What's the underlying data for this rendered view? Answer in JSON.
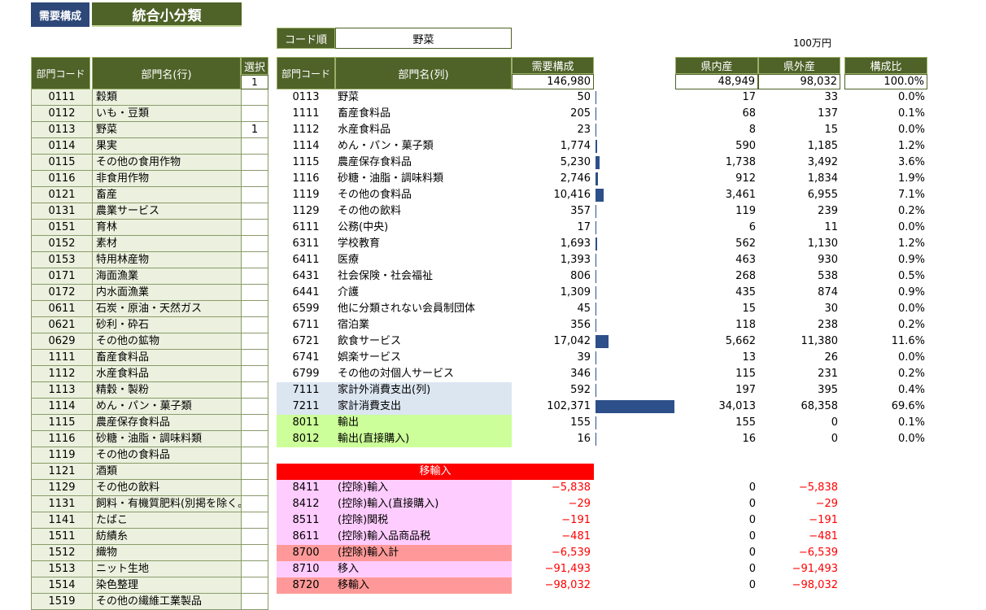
{
  "top": {
    "tab_label": "需要構成",
    "title": "統合小分類"
  },
  "left_headers": {
    "code": "部門コード",
    "name": "部門名(行)",
    "select": "選択",
    "select_value": "1"
  },
  "left_rows": [
    {
      "code": "0111",
      "name": "穀類",
      "sel": ""
    },
    {
      "code": "0112",
      "name": "いも・豆類",
      "sel": ""
    },
    {
      "code": "0113",
      "name": "野菜",
      "sel": "1"
    },
    {
      "code": "0114",
      "name": "果実",
      "sel": ""
    },
    {
      "code": "0115",
      "name": "その他の食用作物",
      "sel": ""
    },
    {
      "code": "0116",
      "name": "非食用作物",
      "sel": ""
    },
    {
      "code": "0121",
      "name": "畜産",
      "sel": ""
    },
    {
      "code": "0131",
      "name": "農業サービス",
      "sel": ""
    },
    {
      "code": "0151",
      "name": "育林",
      "sel": ""
    },
    {
      "code": "0152",
      "name": "素材",
      "sel": ""
    },
    {
      "code": "0153",
      "name": "特用林産物",
      "sel": ""
    },
    {
      "code": "0171",
      "name": "海面漁業",
      "sel": ""
    },
    {
      "code": "0172",
      "name": "内水面漁業",
      "sel": ""
    },
    {
      "code": "0611",
      "name": "石炭・原油・天然ガス",
      "sel": ""
    },
    {
      "code": "0621",
      "name": "砂利・砕石",
      "sel": ""
    },
    {
      "code": "0629",
      "name": "その他の鉱物",
      "sel": ""
    },
    {
      "code": "1111",
      "name": "畜産食料品",
      "sel": ""
    },
    {
      "code": "1112",
      "name": "水産食料品",
      "sel": ""
    },
    {
      "code": "1113",
      "name": "精穀・製粉",
      "sel": ""
    },
    {
      "code": "1114",
      "name": "めん・パン・菓子類",
      "sel": ""
    },
    {
      "code": "1115",
      "name": "農産保存食料品",
      "sel": ""
    },
    {
      "code": "1116",
      "name": "砂糖・油脂・調味料類",
      "sel": ""
    },
    {
      "code": "1119",
      "name": "その他の食料品",
      "sel": ""
    },
    {
      "code": "1121",
      "name": "酒類",
      "sel": ""
    },
    {
      "code": "1129",
      "name": "その他の飲料",
      "sel": ""
    },
    {
      "code": "1131",
      "name": "飼料・有機質肥料(別掲を除く。)",
      "sel": ""
    },
    {
      "code": "1141",
      "name": "たばこ",
      "sel": ""
    },
    {
      "code": "1511",
      "name": "紡績糸",
      "sel": ""
    },
    {
      "code": "1512",
      "name": "織物",
      "sel": ""
    },
    {
      "code": "1513",
      "name": "ニット生地",
      "sel": ""
    },
    {
      "code": "1514",
      "name": "染色整理",
      "sel": ""
    },
    {
      "code": "1519",
      "name": "その他の繊維工業製品",
      "sel": ""
    }
  ],
  "order": {
    "label": "コード順",
    "value": "野菜",
    "unit": "100万円"
  },
  "mid_headers": {
    "code": "部門コード",
    "name": "部門名(列)",
    "demand": "需要構成",
    "demand_total": "146,980",
    "in_pref": "県内産",
    "in_total": "48,949",
    "out_pref": "県外産",
    "out_total": "98,032",
    "ratio": "構成比",
    "ratio_total": "100.0%"
  },
  "rows": [
    {
      "code": "0113",
      "name": "野菜",
      "demand": "50",
      "bar": 50,
      "inp": "17",
      "outp": "33",
      "ratio": "0.0%",
      "bg": ""
    },
    {
      "code": "1111",
      "name": "畜産食料品",
      "demand": "205",
      "bar": 205,
      "inp": "68",
      "outp": "137",
      "ratio": "0.1%",
      "bg": ""
    },
    {
      "code": "1112",
      "name": "水産食料品",
      "demand": "23",
      "bar": 23,
      "inp": "8",
      "outp": "15",
      "ratio": "0.0%",
      "bg": ""
    },
    {
      "code": "1114",
      "name": "めん・パン・菓子類",
      "demand": "1,774",
      "bar": 1774,
      "inp": "590",
      "outp": "1,185",
      "ratio": "1.2%",
      "bg": ""
    },
    {
      "code": "1115",
      "name": "農産保存食料品",
      "demand": "5,230",
      "bar": 5230,
      "inp": "1,738",
      "outp": "3,492",
      "ratio": "3.6%",
      "bg": ""
    },
    {
      "code": "1116",
      "name": "砂糖・油脂・調味料類",
      "demand": "2,746",
      "bar": 2746,
      "inp": "912",
      "outp": "1,834",
      "ratio": "1.9%",
      "bg": ""
    },
    {
      "code": "1119",
      "name": "その他の食料品",
      "demand": "10,416",
      "bar": 10416,
      "inp": "3,461",
      "outp": "6,955",
      "ratio": "7.1%",
      "bg": ""
    },
    {
      "code": "1129",
      "name": "その他の飲料",
      "demand": "357",
      "bar": 357,
      "inp": "119",
      "outp": "239",
      "ratio": "0.2%",
      "bg": ""
    },
    {
      "code": "6111",
      "name": "公務(中央)",
      "demand": "17",
      "bar": 17,
      "inp": "6",
      "outp": "11",
      "ratio": "0.0%",
      "bg": ""
    },
    {
      "code": "6311",
      "name": "学校教育",
      "demand": "1,693",
      "bar": 1693,
      "inp": "562",
      "outp": "1,130",
      "ratio": "1.2%",
      "bg": ""
    },
    {
      "code": "6411",
      "name": "医療",
      "demand": "1,393",
      "bar": 1393,
      "inp": "463",
      "outp": "930",
      "ratio": "0.9%",
      "bg": ""
    },
    {
      "code": "6431",
      "name": "社会保険・社会福祉",
      "demand": "806",
      "bar": 806,
      "inp": "268",
      "outp": "538",
      "ratio": "0.5%",
      "bg": ""
    },
    {
      "code": "6441",
      "name": "介護",
      "demand": "1,309",
      "bar": 1309,
      "inp": "435",
      "outp": "874",
      "ratio": "0.9%",
      "bg": ""
    },
    {
      "code": "6599",
      "name": "他に分類されない会員制団体",
      "demand": "45",
      "bar": 45,
      "inp": "15",
      "outp": "30",
      "ratio": "0.0%",
      "bg": ""
    },
    {
      "code": "6711",
      "name": "宿泊業",
      "demand": "356",
      "bar": 356,
      "inp": "118",
      "outp": "238",
      "ratio": "0.2%",
      "bg": ""
    },
    {
      "code": "6721",
      "name": "飲食サービス",
      "demand": "17,042",
      "bar": 17042,
      "inp": "5,662",
      "outp": "11,380",
      "ratio": "11.6%",
      "bg": ""
    },
    {
      "code": "6741",
      "name": "娯楽サービス",
      "demand": "39",
      "bar": 39,
      "inp": "13",
      "outp": "26",
      "ratio": "0.0%",
      "bg": ""
    },
    {
      "code": "6799",
      "name": "その他の対個人サービス",
      "demand": "346",
      "bar": 346,
      "inp": "115",
      "outp": "231",
      "ratio": "0.2%",
      "bg": ""
    },
    {
      "code": "7111",
      "name": "家計外消費支出(列)",
      "demand": "592",
      "bar": 592,
      "inp": "197",
      "outp": "395",
      "ratio": "0.4%",
      "bg": "#dce6f1"
    },
    {
      "code": "7211",
      "name": "家計消費支出",
      "demand": "102,371",
      "bar": 102371,
      "inp": "34,013",
      "outp": "68,358",
      "ratio": "69.6%",
      "bg": "#dce6f1"
    },
    {
      "code": "8011",
      "name": "輸出",
      "demand": "155",
      "bar": 155,
      "inp": "155",
      "outp": "0",
      "ratio": "0.1%",
      "bg": "#ccff99"
    },
    {
      "code": "8012",
      "name": "輸出(直接購入)",
      "demand": "16",
      "bar": 16,
      "inp": "16",
      "outp": "0",
      "ratio": "0.0%",
      "bg": "#ccff99"
    }
  ],
  "import_title": "移輸入",
  "import_rows": [
    {
      "code": "8411",
      "name": "(控除)輸入",
      "demand": "−5,838",
      "inp": "0",
      "outp": "−5,838",
      "bg": "#ffccff"
    },
    {
      "code": "8412",
      "name": "(控除)輸入(直接購入)",
      "demand": "−29",
      "inp": "0",
      "outp": "−29",
      "bg": "#ffccff"
    },
    {
      "code": "8511",
      "name": "(控除)関税",
      "demand": "−191",
      "inp": "0",
      "outp": "−191",
      "bg": "#ffccff"
    },
    {
      "code": "8611",
      "name": "(控除)輸入品商品税",
      "demand": "−481",
      "inp": "0",
      "outp": "−481",
      "bg": "#ffccff"
    },
    {
      "code": "8700",
      "name": "(控除)輸入計",
      "demand": "−6,539",
      "inp": "0",
      "outp": "−6,539",
      "bg": "#ff9999"
    },
    {
      "code": "8710",
      "name": "移入",
      "demand": "−91,493",
      "inp": "0",
      "outp": "−91,493",
      "bg": "#ffccff"
    },
    {
      "code": "8720",
      "name": "移輸入",
      "demand": "−98,032",
      "inp": "0",
      "outp": "−98,032",
      "bg": "#ff9999"
    }
  ],
  "bar_scale": {
    "max_value": 102371
  },
  "colors": {
    "green": "#4f6228",
    "light_green": "#ebf1de",
    "bar": "#2d4f8a",
    "red": "#ff0000"
  }
}
